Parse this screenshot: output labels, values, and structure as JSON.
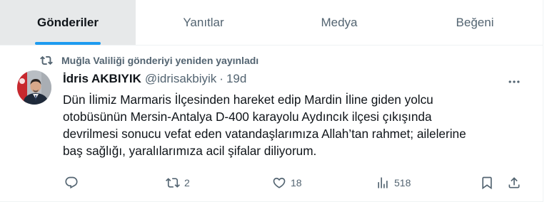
{
  "tabs": [
    {
      "label": "Gönderiler",
      "active": true
    },
    {
      "label": "Yanıtlar",
      "active": false
    },
    {
      "label": "Medya",
      "active": false
    },
    {
      "label": "Beğeni",
      "active": false
    }
  ],
  "tweet": {
    "repost_label": "Muğla Valiliği gönderiyi yeniden yayınladı",
    "author_name": "İdris AKBIYIK",
    "handle": "@idrisakbiyik",
    "separator": "·",
    "time": "19d",
    "text_lines": [
      "Dün İlimiz Marmaris İlçesinden hareket edip Mardin İline giden yolcu",
      "otobüsünün Mersin-Antalya D-400 karayolu Aydıncık ilçesi çıkışında",
      "devrilmesi sonucu vefat eden vatandaşlarımıza Allah’tan rahmet; ailelerine",
      "baş sağlığı, yaralılarımıza acil şifalar diliyorum."
    ],
    "actions": {
      "reply_count": "",
      "repost_count": "2",
      "like_count": "18",
      "view_count": "518"
    },
    "icons": [
      "repost-icon",
      "more-icon",
      "reply-icon",
      "retweet-icon",
      "like-icon",
      "views-icon",
      "bookmark-icon",
      "share-icon"
    ]
  },
  "colors": {
    "text": "#0f1419",
    "muted": "#536471",
    "accent": "#1d9bf0",
    "active_tab_bg": "#e7e9ea"
  }
}
